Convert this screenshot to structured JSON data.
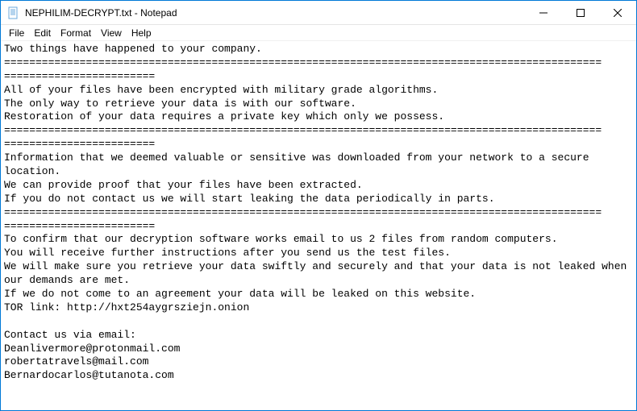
{
  "titlebar": {
    "title": "NEPHILIM-DECRYPT.txt - Notepad"
  },
  "menubar": {
    "file": "File",
    "edit": "Edit",
    "format": "Format",
    "view": "View",
    "help": "Help"
  },
  "content": {
    "text": "Two things have happened to your company.\n===============================================================================================\n========================\nAll of your files have been encrypted with military grade algorithms.\nThe only way to retrieve your data is with our software.\nRestoration of your data requires a private key which only we possess.\n===============================================================================================\n========================\nInformation that we deemed valuable or sensitive was downloaded from your network to a secure location.\nWe can provide proof that your files have been extracted.\nIf you do not contact us we will start leaking the data periodically in parts.\n===============================================================================================\n========================\nTo confirm that our decryption software works email to us 2 files from random computers.\nYou will receive further instructions after you send us the test files.\nWe will make sure you retrieve your data swiftly and securely and that your data is not leaked when our demands are met.\nIf we do not come to an agreement your data will be leaked on this website.\nTOR link: http://hxt254aygrsziejn.onion\n\nContact us via email:\nDeanlivermore@protonmail.com\nrobertatravels@mail.com\nBernardocarlos@tutanota.com"
  }
}
